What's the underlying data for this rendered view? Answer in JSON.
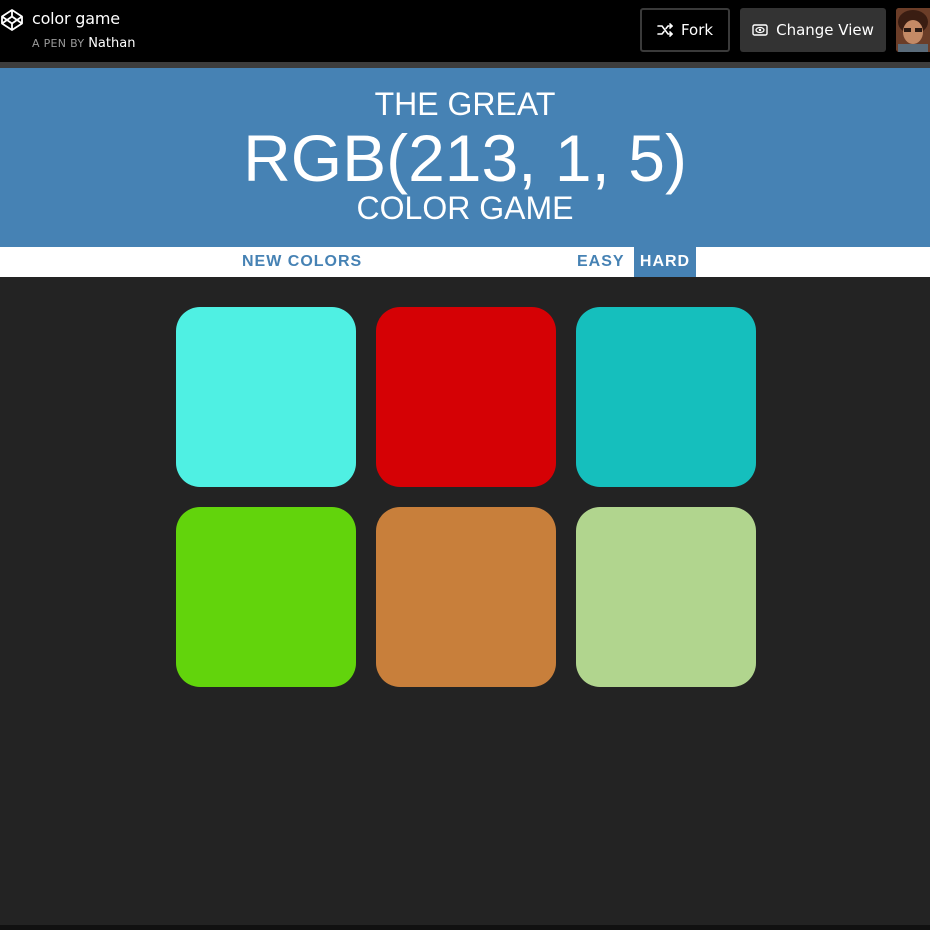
{
  "codepen": {
    "title": "color game",
    "byline_prefix": "A PEN BY",
    "author": "Nathan",
    "fork_label": "Fork",
    "change_view_label": "Change View",
    "icons": [
      "codepen-logo-icon",
      "fork-icon",
      "eye-icon",
      "avatar"
    ]
  },
  "game": {
    "header_line1": "THE GREAT",
    "target_color": "RGB(213, 1, 5)",
    "header_line3": "COLOR GAME",
    "new_colors_label": "NEW COLORS",
    "easy_label": "EASY",
    "hard_label": "HARD",
    "selected_mode": "HARD",
    "header_color": "#4682b4",
    "background_color": "#232323",
    "squares": [
      {
        "color": "#4ff0e3"
      },
      {
        "color": "#d50105"
      },
      {
        "color": "#15bfbd"
      },
      {
        "color": "#62d40c"
      },
      {
        "color": "#c87f3b"
      },
      {
        "color": "#b1d58e"
      }
    ]
  }
}
